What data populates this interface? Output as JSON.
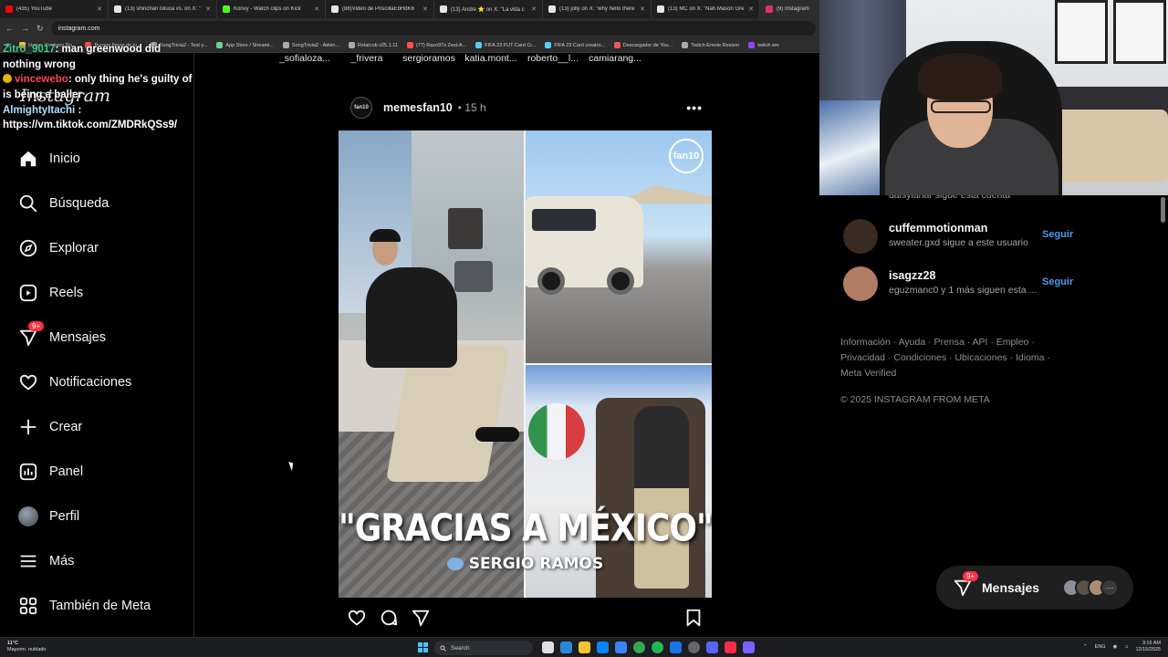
{
  "browser": {
    "tabs": [
      {
        "title": "(435) YouTube",
        "color": "#ff0000"
      },
      {
        "title": "(13) shinchan toluca vs. on X: \"",
        "color": "#e6e6e6"
      },
      {
        "title": "Konvy - Watch clips on Kick",
        "color": "#53fc18"
      },
      {
        "title": "(88)Video de PriscillaEbHdK6",
        "color": "#e6e6e6"
      },
      {
        "title": "(13) Andre ⭐ on X: \"La vida c",
        "color": "#e6e6e6"
      },
      {
        "title": "(13) jolly on X: \"why hello there",
        "color": "#e6e6e6"
      },
      {
        "title": "(13) MC on X: \"Nah Mason Gre",
        "color": "#e6e6e6"
      },
      {
        "title": "(9) Instagram",
        "color": "#e1306c",
        "active": true
      }
    ],
    "url": "instagram.com",
    "bookmarks": [
      {
        "label": "Happy Cristiano Ro...",
        "color": "#f2c94c"
      },
      {
        "label": "Buraqo figura de tu...",
        "color": "#ff4d4d"
      },
      {
        "label": "SongTrivia2 - Test y...",
        "color": "#aaaaaa"
      },
      {
        "label": "App Store / Streami...",
        "color": "#6fcf97"
      },
      {
        "label": "SongTrivia2 - Advin...",
        "color": "#aaaaaa"
      },
      {
        "label": "Relatcob v25.1.11",
        "color": "#aaaaaa"
      },
      {
        "label": "(77) Razo97s Zest-A...",
        "color": "#ff4d4d"
      },
      {
        "label": "FIFA 23 FUT Card Cr...",
        "color": "#56ccf2"
      },
      {
        "label": "FIFA 23 Card creator...",
        "color": "#56ccf2"
      },
      {
        "label": "Descargador de You...",
        "color": "#eb5757"
      },
      {
        "label": "Twitch Emote Resizer",
        "color": "#aaaaaa"
      },
      {
        "label": "twitch em",
        "color": "#9146ff"
      }
    ]
  },
  "chat": {
    "line1_user": "Zitro_9017",
    "line1_text": ": man greenwood did nothing wrong",
    "line2_user": "vincewebo",
    "line2_text": ": only thing he's guilty of is being a baller",
    "line3_user": "AlmightyItachi",
    "line3_text": ":",
    "line4_text": "https://vm.tiktok.com/ZMDRkQSs9/"
  },
  "sidebar": {
    "logo": "Instagram",
    "items": [
      {
        "label": "Inicio",
        "icon": "home-icon"
      },
      {
        "label": "Búsqueda",
        "icon": "search-icon"
      },
      {
        "label": "Explorar",
        "icon": "compass-icon"
      },
      {
        "label": "Reels",
        "icon": "reels-icon"
      },
      {
        "label": "Mensajes",
        "icon": "messages-icon",
        "badge": "9+"
      },
      {
        "label": "Notificaciones",
        "icon": "heart-icon"
      },
      {
        "label": "Crear",
        "icon": "plus-icon"
      },
      {
        "label": "Panel",
        "icon": "dashboard-icon"
      },
      {
        "label": "Perfil",
        "icon": "avatar"
      },
      {
        "label": "Más",
        "icon": "menu-icon"
      },
      {
        "label": "También de Meta",
        "icon": "meta-apps-icon"
      }
    ]
  },
  "stories": [
    "_sofialoza...",
    "_frivera",
    "sergioramos",
    "katia.mont...",
    "roberto__l...",
    "camiarang..."
  ],
  "post": {
    "avatar_text": "fan10",
    "username": "memesfan10",
    "time": "• 15 h",
    "more": "•••",
    "badge": "fan10",
    "headline": "\"GRACIAS A MÉXICO\"",
    "byline": "SERGIO RAMOS"
  },
  "suggestions": [
    {
      "name": "cuffemmotionman",
      "sub": "sweater.gxd sigue a este usuario",
      "follow": "Seguir",
      "color": "#3a2a1f"
    },
    {
      "name": "isagzz28",
      "sub": "eguzmanc0 y 1 más siguen esta ...",
      "follow": "Seguir",
      "color": "#b07d64"
    }
  ],
  "partial_suggestion": "daisyiahar sigue esta cuenta",
  "footer": {
    "links": "Información · Ayuda · Prensa · API · Empleo · Privacidad · Condiciones · Ubicaciones · Idioma · Meta Verified",
    "copyright": "© 2025 INSTAGRAM FROM META"
  },
  "messages_pill": {
    "label": "Mensajes",
    "badge": "9+",
    "more": "···"
  },
  "taskbar": {
    "weather_temp": "11°C",
    "weather_desc": "Mayorm. nublado",
    "search": "Search",
    "lang": "ENG",
    "time": "3:16 AM",
    "date": "12/15/2025"
  }
}
